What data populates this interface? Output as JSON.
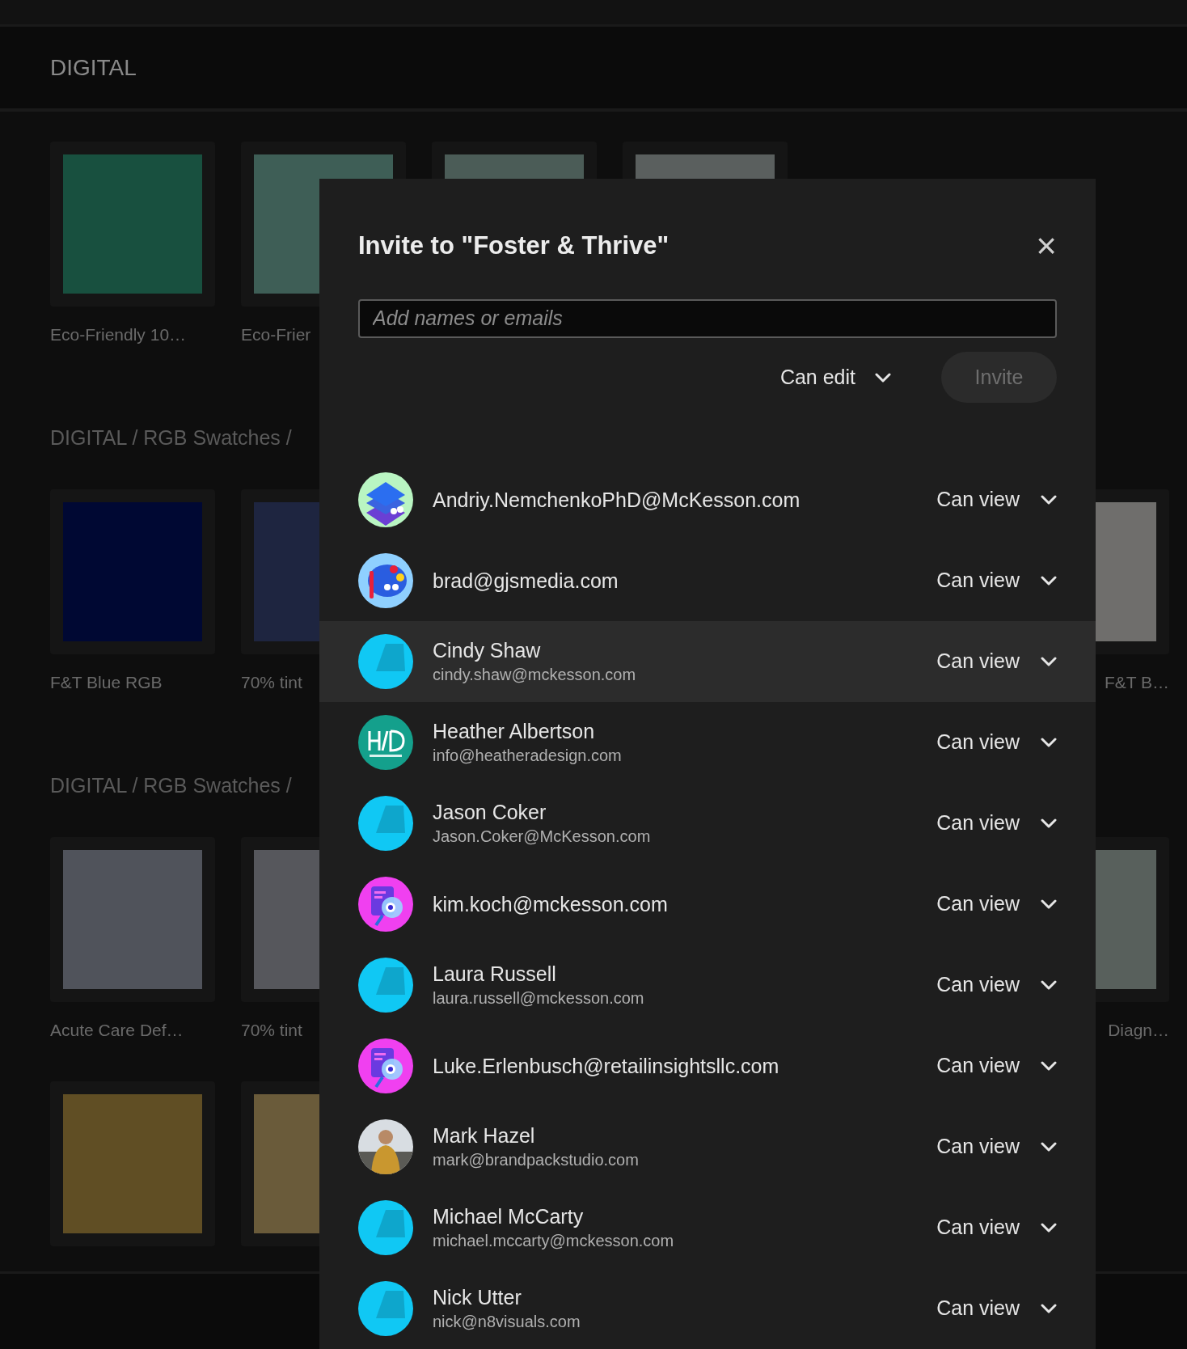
{
  "header": {
    "title": "DIGITAL"
  },
  "groups": [
    {
      "rows": [
        {
          "left": [
            {
              "color": "#18503f",
              "label": "Eco-Friendly 10…"
            },
            {
              "color": "#3e5e56",
              "label": "Eco-Frier"
            },
            {
              "color": "#4b5c57"
            },
            {
              "color": "#5a5f5e"
            }
          ]
        }
      ]
    },
    {
      "heading": "DIGITAL / RGB Swatches /",
      "rows": [
        {
          "left": [
            {
              "color": "#000833",
              "label": "F&T Blue RGB"
            },
            {
              "color": "#1e2540",
              "label": "70% tint"
            }
          ],
          "right": {
            "color": "#6f6e6c",
            "label": "F&T B…"
          }
        }
      ]
    },
    {
      "heading": "DIGITAL / RGB Swatches /",
      "rows": [
        {
          "left": [
            {
              "color": "#50535b",
              "label": "Acute Care Def…"
            },
            {
              "color": "#56575c",
              "label": "70% tint"
            }
          ],
          "right": {
            "color": "#58605c",
            "label": "Diagn…"
          }
        },
        {
          "left": [
            {
              "color": "#604e24"
            },
            {
              "color": "#6a5b3a"
            }
          ]
        }
      ]
    }
  ],
  "dialog": {
    "title": "Invite to \"Foster & Thrive\"",
    "close": "×",
    "input": {
      "placeholder": "Add names or emails"
    },
    "permission": {
      "label": "Can edit"
    },
    "invite": {
      "label": "Invite",
      "disabled": true
    },
    "members": [
      {
        "email": "Andriy.NemchenkoPhD@McKesson.com",
        "role": "Can view",
        "avatar": {
          "kind": "layers"
        },
        "highlighted": false
      },
      {
        "email": "brad@gjsmedia.com",
        "role": "Can view",
        "avatar": {
          "kind": "palette"
        },
        "highlighted": false
      },
      {
        "name": "Cindy Shaw",
        "email": "cindy.shaw@mckesson.com",
        "role": "Can view",
        "avatar": {
          "kind": "default"
        },
        "highlighted": true
      },
      {
        "name": "Heather Albertson",
        "email": "info@heatheradesign.com",
        "role": "Can view",
        "avatar": {
          "kind": "logo"
        },
        "highlighted": false
      },
      {
        "name": "Jason Coker",
        "email": "Jason.Coker@McKesson.com",
        "role": "Can view",
        "avatar": {
          "kind": "default"
        },
        "highlighted": false
      },
      {
        "email": "kim.koch@mckesson.com",
        "role": "Can view",
        "avatar": {
          "kind": "document"
        },
        "highlighted": false
      },
      {
        "name": "Laura Russell",
        "email": "laura.russell@mckesson.com",
        "role": "Can view",
        "avatar": {
          "kind": "default"
        },
        "highlighted": false
      },
      {
        "email": "Luke.Erlenbusch@retailinsightsllc.com",
        "role": "Can view",
        "avatar": {
          "kind": "document"
        },
        "highlighted": false
      },
      {
        "name": "Mark Hazel",
        "email": "mark@brandpackstudio.com",
        "role": "Can view",
        "avatar": {
          "kind": "photo"
        },
        "highlighted": false
      },
      {
        "name": "Michael McCarty",
        "email": "michael.mccarty@mckesson.com",
        "role": "Can view",
        "avatar": {
          "kind": "default"
        },
        "highlighted": false
      },
      {
        "name": "Nick Utter",
        "email": "nick@n8visuals.com",
        "role": "Can view",
        "avatar": {
          "kind": "default"
        },
        "highlighted": false
      }
    ]
  }
}
